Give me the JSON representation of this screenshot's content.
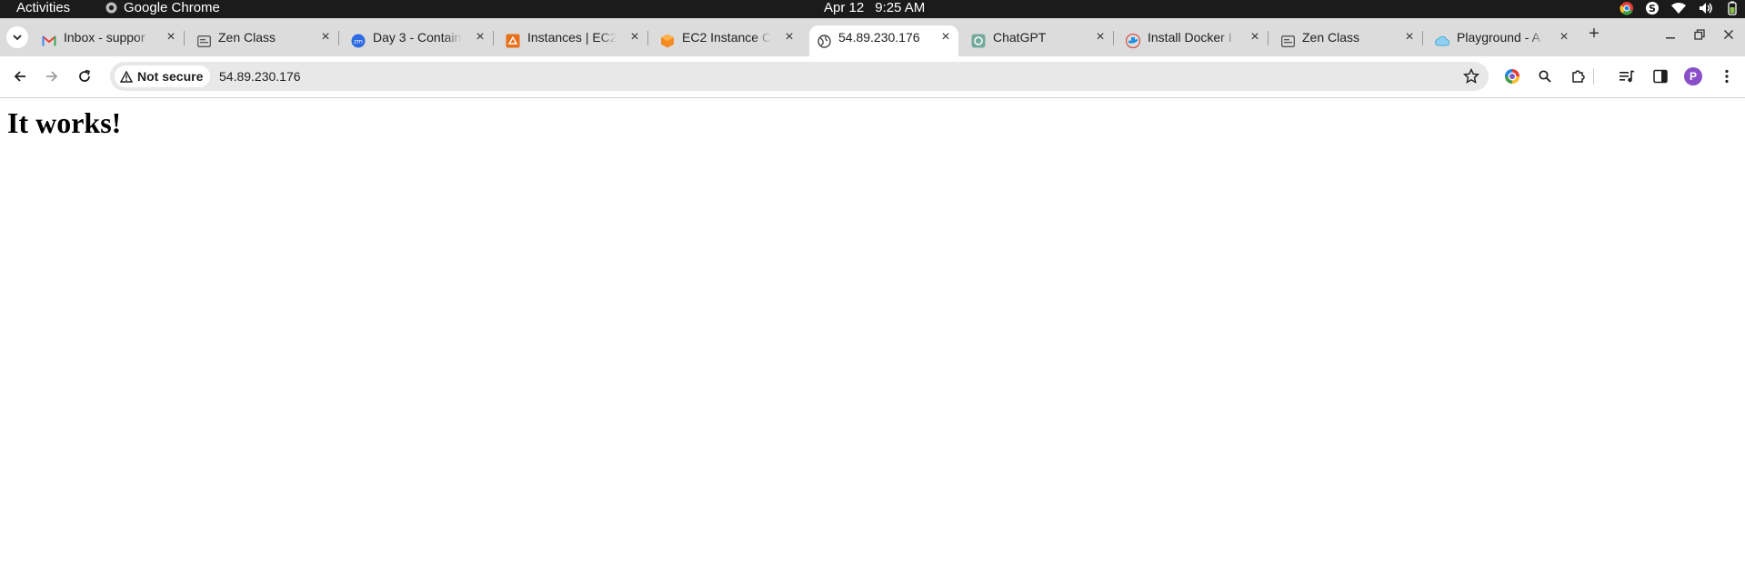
{
  "system_bar": {
    "activities": "Activities",
    "app_name": "Google Chrome",
    "date": "Apr 12",
    "time": "9:25 AM",
    "tray_icons": [
      "chrome-icon",
      "skype-icon",
      "wifi-icon",
      "volume-icon",
      "battery-icon"
    ]
  },
  "tabs": [
    {
      "title": "Inbox - suppor",
      "icon": "gmail-icon",
      "active": false
    },
    {
      "title": "Zen Class",
      "icon": "page-icon",
      "active": false
    },
    {
      "title": "Day 3 - Contain",
      "icon": "zoom-icon",
      "active": false
    },
    {
      "title": "Instances | EC2",
      "icon": "aws-icon",
      "active": false
    },
    {
      "title": "EC2 Instance C",
      "icon": "ec2-icon",
      "active": false
    },
    {
      "title": "54.89.230.176",
      "icon": "globe-icon",
      "active": true
    },
    {
      "title": "ChatGPT",
      "icon": "chatgpt-icon",
      "active": false
    },
    {
      "title": "Install Docker I",
      "icon": "docker-icon",
      "active": false
    },
    {
      "title": "Zen Class",
      "icon": "page-icon",
      "active": false
    },
    {
      "title": "Playground - A",
      "icon": "cloud-icon",
      "active": false
    }
  ],
  "address_bar": {
    "security_label": "Not secure",
    "url": "54.89.230.176"
  },
  "profile": {
    "initial": "P"
  },
  "colors": {
    "topbar": "#1b1b1b",
    "tabstrip": "#dcdcdc",
    "omnibox": "#e8e8e8",
    "avatar": "#8a4fc8"
  },
  "page": {
    "heading": "It works!"
  }
}
